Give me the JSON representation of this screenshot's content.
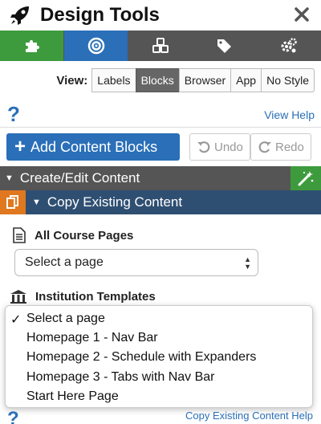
{
  "header": {
    "title": "Design Tools",
    "icon": "rocket-icon",
    "close_icon": "close-icon"
  },
  "tabs": [
    {
      "icon": "puzzle-icon",
      "color": "#3d9b3d",
      "active": false
    },
    {
      "icon": "target-icon",
      "color": "#2a6fb8",
      "active": true
    },
    {
      "icon": "cubes-icon",
      "color": "#555555",
      "active": false
    },
    {
      "icon": "tags-icon",
      "color": "#555555",
      "active": false
    },
    {
      "icon": "gears-icon",
      "color": "#555555",
      "active": false
    }
  ],
  "view": {
    "label": "View:",
    "options": [
      "Labels",
      "Blocks",
      "Browser",
      "App",
      "No Style"
    ],
    "selected": "Blocks"
  },
  "help": {
    "question_mark": "?",
    "view_help": "View Help"
  },
  "actions": {
    "add_blocks": "Add Content Blocks",
    "add_icon": "+",
    "undo": "Undo",
    "redo": "Redo"
  },
  "sections": {
    "create_edit": "Create/Edit Content",
    "copy_existing": "Copy Existing Content"
  },
  "course_pages": {
    "label": "All Course Pages",
    "select_value": "Select a page"
  },
  "institution": {
    "label": "Institution Templates",
    "dropdown_options": [
      "Select a page",
      "Homepage 1 - Nav Bar",
      "Homepage 2 - Schedule with Expanders",
      "Homepage 3 - Tabs with Nav Bar",
      "Start Here Page"
    ],
    "selected_index": 0,
    "check": "✓"
  },
  "footer": {
    "question_mark": "?",
    "help_link": "Copy Existing Content Help"
  },
  "colors": {
    "accent": "#2a6fb8",
    "green": "#3d9b3d",
    "orange": "#e0781f",
    "dark": "#555555",
    "navy": "#2f4f72"
  }
}
